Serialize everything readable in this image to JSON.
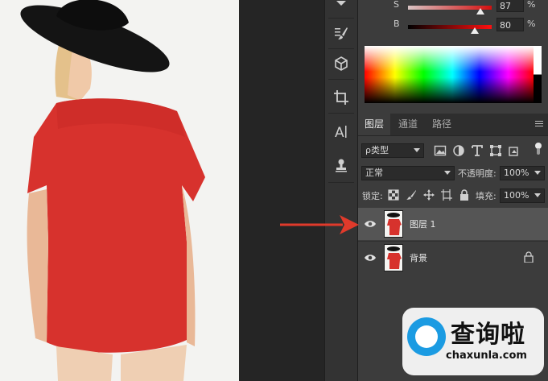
{
  "color_panel": {
    "sliders": [
      {
        "label": "S",
        "value": "87",
        "unit": "%",
        "thumb_fraction": 0.87
      },
      {
        "label": "B",
        "value": "80",
        "unit": "%",
        "thumb_fraction": 0.8
      }
    ]
  },
  "layers_panel": {
    "tabs": [
      "图层",
      "通道",
      "路径"
    ],
    "active_tab": "图层",
    "filter": {
      "value": "ρ类型"
    },
    "blend_mode": {
      "value": "正常"
    },
    "opacity": {
      "label": "不透明度:",
      "value": "100%"
    },
    "lock_label": "锁定:",
    "fill": {
      "label": "填充:",
      "value": "100%"
    },
    "layers": [
      {
        "name": "图层 1",
        "visible": true,
        "selected": true,
        "locked": false
      },
      {
        "name": "背景",
        "visible": true,
        "selected": false,
        "locked": true
      }
    ]
  },
  "toolbar": {
    "tools": [
      "tool-top-icon",
      "adjust-brush-icon",
      "3d-cube-icon",
      "crop-icon",
      "character-icon",
      "stamp-icon"
    ]
  },
  "annotation": {
    "arrow_color": "#e03a2b"
  },
  "watermark": {
    "title": "查询啦",
    "site": "chaxunla.com",
    "logo_color": "#1b9be2"
  }
}
